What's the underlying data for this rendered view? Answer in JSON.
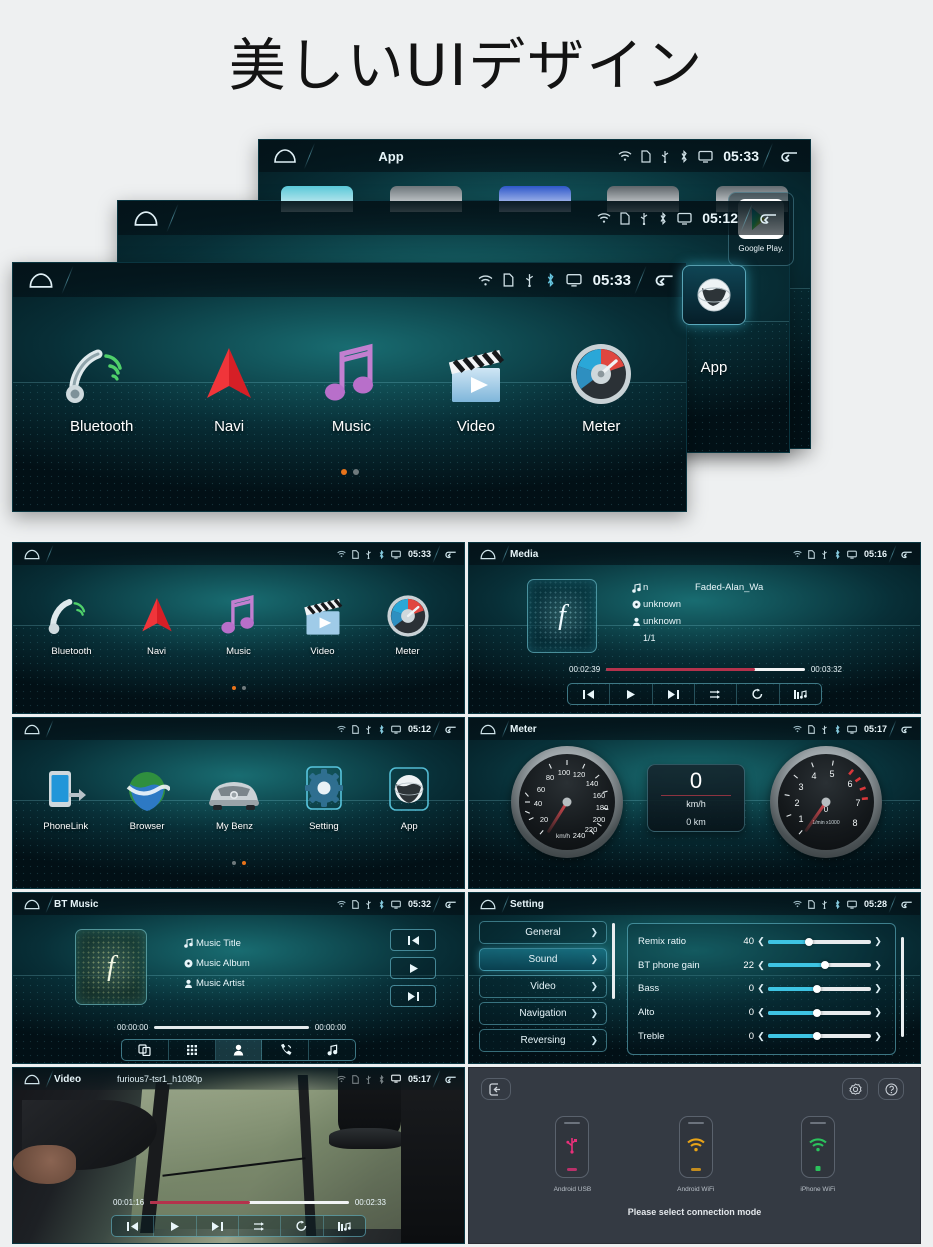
{
  "page": {
    "title": "美しいUIデザイン",
    "background": "#eef0f1"
  },
  "colors": {
    "accent_cyan": "#3ec4e3",
    "accent_orange": "#e8731a",
    "progress_red": "#b4324c",
    "screen_teal": "#1c787c",
    "panel_dark": "#343a43"
  },
  "status_icons": [
    "wifi-icon",
    "sdcard-icon",
    "usb-icon",
    "bluetooth-icon",
    "screen-icon"
  ],
  "hero": {
    "back": {
      "title": "App",
      "time": "05:33",
      "home_icon": "home-icon",
      "back_icon": "back-arrow-icon",
      "google_play": {
        "label": "Google Play.",
        "icon": "google-play-icon"
      }
    },
    "mid": {
      "title": "",
      "time": "05:12",
      "home_icon": "home-icon",
      "back_icon": "back-arrow-icon",
      "app_tile": {
        "label": "App",
        "icon": "globe-icon"
      }
    },
    "front": {
      "title": "",
      "time": "05:33",
      "home_icon": "home-icon",
      "back_icon": "back-arrow-icon",
      "items": [
        {
          "label": "Bluetooth",
          "icon": "bluetooth-handset-icon"
        },
        {
          "label": "Navi",
          "icon": "navigation-arrow-icon"
        },
        {
          "label": "Music",
          "icon": "music-note-icon"
        },
        {
          "label": "Video",
          "icon": "clapperboard-icon"
        },
        {
          "label": "Meter",
          "icon": "speedometer-icon"
        }
      ],
      "page_dots": {
        "count": 2,
        "active": 0
      }
    }
  },
  "grid": {
    "home1": {
      "title": "",
      "time": "05:33",
      "items": [
        {
          "label": "Bluetooth",
          "icon": "bluetooth-handset-icon"
        },
        {
          "label": "Navi",
          "icon": "navigation-arrow-icon"
        },
        {
          "label": "Music",
          "icon": "music-note-icon"
        },
        {
          "label": "Video",
          "icon": "clapperboard-icon"
        },
        {
          "label": "Meter",
          "icon": "speedometer-icon"
        }
      ],
      "page_dots": {
        "count": 2,
        "active": 0
      }
    },
    "media": {
      "title": "Media",
      "time": "05:16",
      "track_prefix": "n",
      "track": "Faded-Alan_Wa",
      "album": "unknown",
      "artist": "unknown",
      "index": "1/1",
      "elapsed": "00:02:39",
      "duration": "00:03:32",
      "progress_percent": 75,
      "controls": [
        "previous-icon",
        "play-icon",
        "next-icon",
        "shuffle-icon",
        "repeat-icon",
        "playlist-icon"
      ]
    },
    "home2": {
      "title": "",
      "time": "05:12",
      "items": [
        {
          "label": "PhoneLink",
          "icon": "phonelink-icon"
        },
        {
          "label": "Browser",
          "icon": "browser-globe-icon"
        },
        {
          "label": "My Benz",
          "icon": "car-icon"
        },
        {
          "label": "Setting",
          "icon": "gear-icon"
        },
        {
          "label": "App",
          "icon": "globe-icon"
        }
      ],
      "page_dots": {
        "count": 2,
        "active": 1
      }
    },
    "meter": {
      "title": "Meter",
      "time": "05:17",
      "speedometer": {
        "ticks": [
          "20",
          "40",
          "60",
          "80",
          "100",
          "120",
          "140",
          "160",
          "180",
          "200",
          "220",
          "240"
        ],
        "unit": "km/h",
        "value": 0,
        "max": 240
      },
      "center": {
        "value": "0",
        "unit": "km/h",
        "odometer": "0 km"
      },
      "tachometer": {
        "ticks": [
          "1",
          "2",
          "3",
          "4",
          "5",
          "6",
          "7",
          "8"
        ],
        "unit": "1/min x1000",
        "value": "0",
        "redline_from": 6
      }
    },
    "btmusic": {
      "title": "BT Music",
      "time": "05:32",
      "track": "Music Title",
      "album": "Music Album",
      "artist": "Music Artist",
      "elapsed": "00:00:00",
      "duration": "00:00:00",
      "progress_percent": 0,
      "side_controls": [
        "previous-icon",
        "play-icon",
        "next-icon"
      ],
      "tabs": [
        "bt-link-icon",
        "dialpad-icon",
        "contacts-icon",
        "call-history-icon",
        "music-icon"
      ],
      "active_tab": 2
    },
    "setting": {
      "title": "Setting",
      "time": "05:28",
      "menu": [
        {
          "label": "General",
          "selected": false
        },
        {
          "label": "Sound",
          "selected": true
        },
        {
          "label": "Video",
          "selected": false
        },
        {
          "label": "Navigation",
          "selected": false
        },
        {
          "label": "Reversing",
          "selected": false
        }
      ],
      "sliders": [
        {
          "label": "Remix ratio",
          "value": "40",
          "percent": 40
        },
        {
          "label": "BT phone gain",
          "value": "22",
          "percent": 55
        },
        {
          "label": "Bass",
          "value": "0",
          "percent": 48
        },
        {
          "label": "Alto",
          "value": "0",
          "percent": 48
        },
        {
          "label": "Treble",
          "value": "0",
          "percent": 48
        }
      ]
    },
    "video": {
      "title": "Video",
      "filename": "furious7-tsr1_h1080p",
      "time": "05:17",
      "elapsed": "00:01:16",
      "duration": "00:02:33",
      "progress_percent": 50,
      "controls": [
        "previous-icon",
        "play-icon",
        "next-icon",
        "shuffle-icon",
        "repeat-icon",
        "playlist-icon"
      ]
    },
    "connection": {
      "back_icon": "exit-icon",
      "gear_icon": "gear-icon",
      "help_icon": "help-icon",
      "modes": [
        {
          "label": "Android USB",
          "icon": "usb-icon",
          "color": "#e8307a"
        },
        {
          "label": "Android WiFi",
          "icon": "wifi-icon",
          "color": "#e8a317"
        },
        {
          "label": "iPhone WiFi",
          "icon": "wifi-icon",
          "color": "#2bc25c"
        }
      ],
      "hint": "Please select connection mode"
    }
  }
}
